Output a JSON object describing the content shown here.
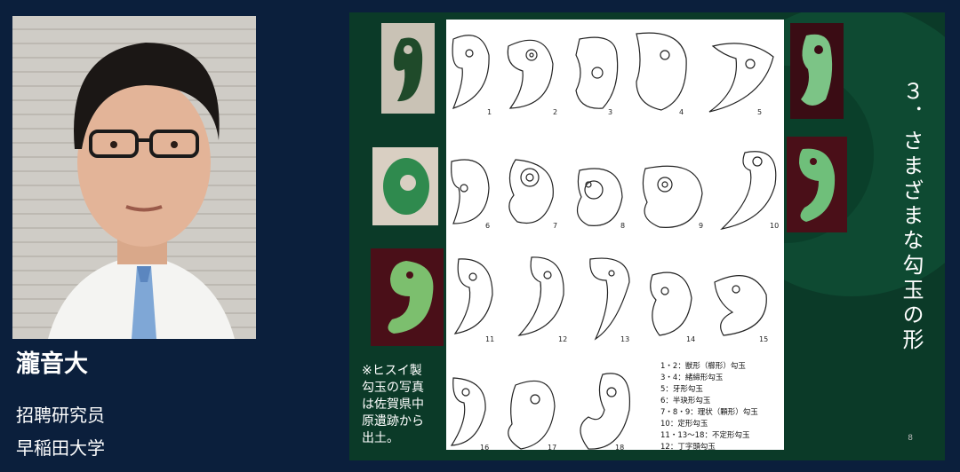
{
  "presenter": {
    "name": "瀧音大",
    "title": "招聘研究员",
    "affiliation": "早稲田大学"
  },
  "slide": {
    "title": "３．さまざまな勾玉の形",
    "note": [
      "※ヒスイ製",
      "勾玉の写真",
      "は佐賀県中",
      "原遺跡から",
      "出土。"
    ],
    "page_number": "8",
    "figure_numbers": [
      "1",
      "2",
      "3",
      "4",
      "5",
      "6",
      "7",
      "8",
      "9",
      "10",
      "11",
      "12",
      "13",
      "14",
      "15",
      "16",
      "17",
      "18"
    ],
    "legend": [
      "1・2：獣形（櫛形）勾玉",
      "3・4：緒締形勾玉",
      "5：牙形勾玉",
      "6：半玦形勾玉",
      "7・8・9：理状（顆形）勾玉",
      "10：定形勾玉",
      "11・13～18：不定形勾玉",
      "12：丁字頭勾玉"
    ]
  },
  "colors": {
    "background": "#0b1f3c",
    "slide_green": "#0b3a28",
    "jade_dark": "#1f4a2a",
    "jade_light": "#6fbf7a"
  }
}
